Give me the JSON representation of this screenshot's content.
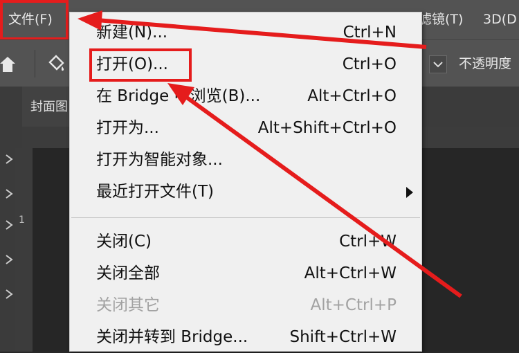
{
  "menubar": {
    "file": "文件(F)",
    "filter": "滤镜(T)",
    "three_d": "3D(D"
  },
  "options_bar": {
    "opacity_label": "不透明度"
  },
  "document": {
    "tab_label": "封面图",
    "ruler_mark": "1"
  },
  "file_menu": {
    "items": [
      {
        "label": "新建(N)...",
        "shortcut": "Ctrl+N",
        "enabled": true
      },
      {
        "label": "打开(O)...",
        "shortcut": "Ctrl+O",
        "enabled": true,
        "highlighted": true
      },
      {
        "label": "在 Bridge 中浏览(B)...",
        "shortcut": "Alt+Ctrl+O",
        "enabled": true
      },
      {
        "label": "打开为...",
        "shortcut": "Alt+Shift+Ctrl+O",
        "enabled": true
      },
      {
        "label": "打开为智能对象...",
        "shortcut": "",
        "enabled": true
      },
      {
        "label": "最近打开文件(T)",
        "shortcut": "",
        "enabled": true,
        "submenu": true
      },
      {
        "label": "关闭(C)",
        "shortcut": "Ctrl+W",
        "enabled": true
      },
      {
        "label": "关闭全部",
        "shortcut": "Alt+Ctrl+W",
        "enabled": true
      },
      {
        "label": "关闭其它",
        "shortcut": "Alt+Ctrl+P",
        "enabled": false
      },
      {
        "label": "关闭并转到 Bridge...",
        "shortcut": "Shift+Ctrl+W",
        "enabled": true
      }
    ]
  },
  "annotation": {
    "color": "#e51c1c"
  },
  "icons": {
    "home": "home-icon",
    "paint_bucket": "paint-bucket-icon",
    "chevron_down": "chevron-down-icon",
    "submenu_arrow": "chevron-right-icon"
  }
}
